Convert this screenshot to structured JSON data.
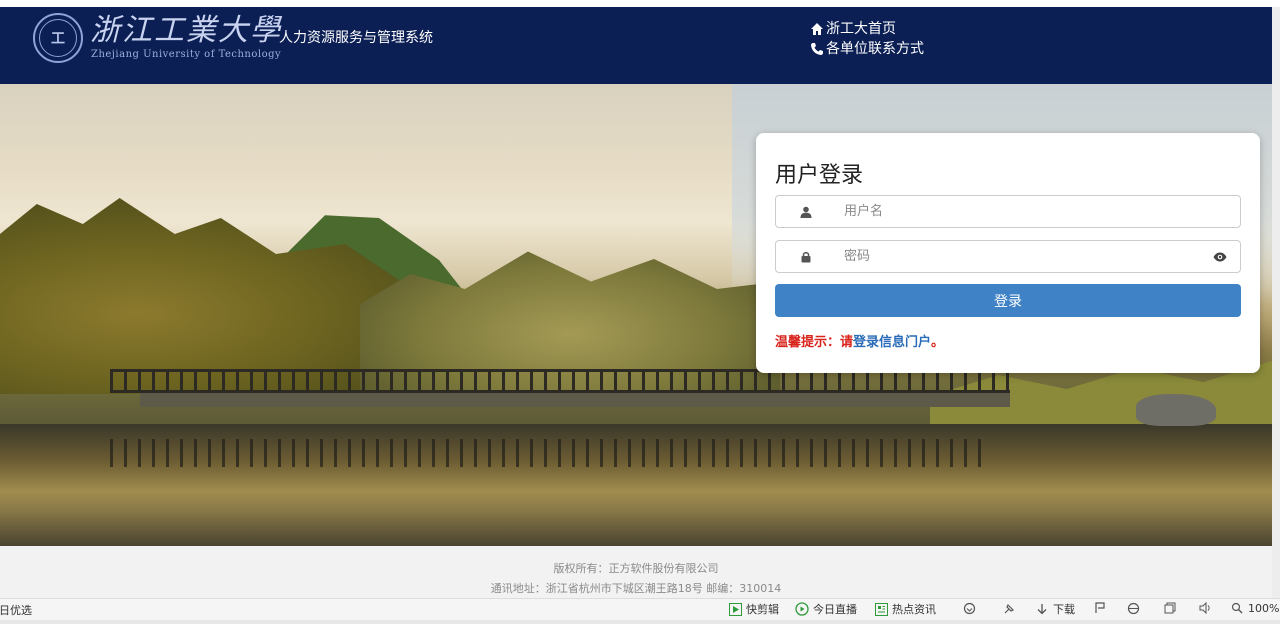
{
  "header": {
    "logo_cn": "浙江工業大學",
    "logo_en": "Zhejiang University of Technology",
    "logo_seal": "工",
    "system_title": "人力资源服务与管理系统",
    "links": [
      {
        "label": "浙工大首页",
        "icon": "home-icon"
      },
      {
        "label": "各单位联系方式",
        "icon": "phone-icon"
      }
    ]
  },
  "login": {
    "title": "用户登录",
    "username_placeholder": "用户名",
    "password_placeholder": "密码",
    "button_label": "登录",
    "tip_prefix": "温馨提示：请",
    "tip_link": "登录信息门户",
    "tip_suffix": "。"
  },
  "footer": {
    "copyright": "版权所有：正方软件股份有限公司",
    "address": "通讯地址：浙江省杭州市下城区潮王路18号 邮编：310014"
  },
  "statusbar": {
    "left_text": "今日优选",
    "items": [
      {
        "label": "快剪辑",
        "icon": "scissors-icon"
      },
      {
        "label": "今日直播",
        "icon": "live-icon"
      },
      {
        "label": "热点资讯",
        "icon": "news-icon"
      },
      {
        "label": "",
        "icon": "refresh-icon"
      },
      {
        "label": "",
        "icon": "pin-icon"
      },
      {
        "label": "下载",
        "icon": "download-icon"
      },
      {
        "label": "",
        "icon": "flag-icon"
      },
      {
        "label": "",
        "icon": "ie-icon"
      },
      {
        "label": "",
        "icon": "window-icon"
      },
      {
        "label": "",
        "icon": "speaker-icon"
      },
      {
        "label": "100%",
        "icon": "zoom-icon"
      }
    ]
  },
  "colors": {
    "header_bg": "#0b1f55",
    "button_bg": "#3f82c6",
    "tip_red": "#d9241c",
    "tip_link": "#2a6cb8"
  }
}
